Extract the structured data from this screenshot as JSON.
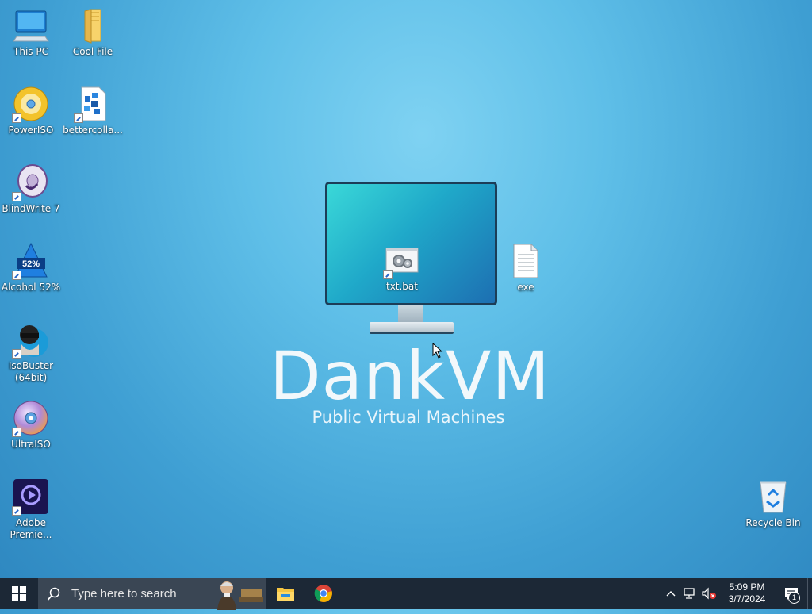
{
  "wallpaper": {
    "title": "DankVM",
    "subtitle": "Public Virtual Machines"
  },
  "desktop_icons": [
    {
      "label": "This PC",
      "icon": "computer-icon"
    },
    {
      "label": "Cool File",
      "icon": "folder-icon"
    },
    {
      "label": "PowerISO",
      "icon": "poweriso-icon"
    },
    {
      "label": "bettercolla...",
      "icon": "blue-blocks-icon"
    },
    {
      "label": "BlindWrite 7",
      "icon": "blindwrite-disc-icon"
    },
    {
      "label": "Alcohol 52%",
      "icon": "alcohol-icon"
    },
    {
      "label": "IsoBuster\n(64bit)",
      "icon": "isobuster-icon"
    },
    {
      "label": "UltraISO",
      "icon": "ultraiso-disc-icon"
    },
    {
      "label": "Adobe\nPremie...",
      "icon": "premiere-icon"
    },
    {
      "label": "txt.bat",
      "icon": "batch-file-icon"
    },
    {
      "label": "exe",
      "icon": "text-document-icon"
    },
    {
      "label": "Recycle Bin",
      "icon": "recycle-bin-icon"
    }
  ],
  "taskbar": {
    "search_placeholder": "Type here to search",
    "pinned_apps": [
      "file-explorer-icon",
      "chrome-icon"
    ],
    "clock_time": "5:09 PM",
    "clock_date": "3/7/2024",
    "notification_count": "1"
  },
  "colors": {
    "taskbar": "#1c2836",
    "search_box": "#3a4654",
    "desktop_top": "#7fd2f2",
    "desktop_bottom": "#2d86bf"
  }
}
